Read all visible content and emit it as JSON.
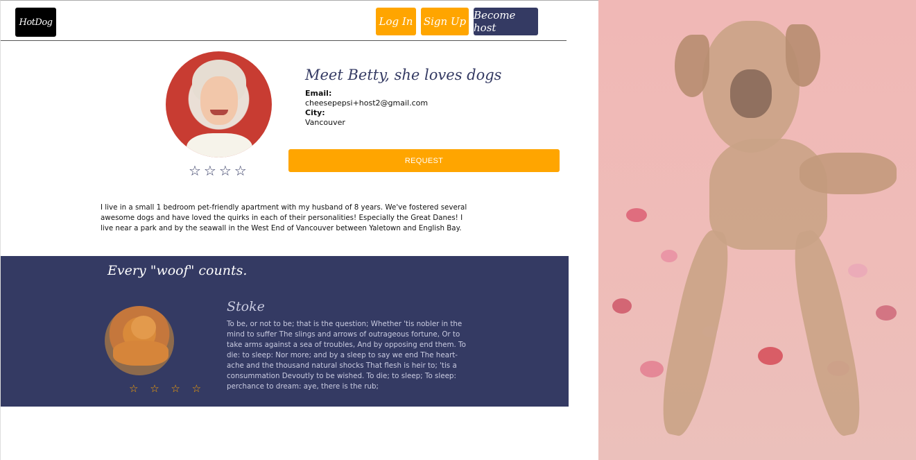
{
  "nav": {
    "logo": "HotDog",
    "login_label": "Log In",
    "signup_label": "Sign Up",
    "host_label": "Become host"
  },
  "host": {
    "title": "Meet Betty, she loves dogs",
    "email_label": "Email:",
    "email": "cheesepepsi+host2@gmail.com",
    "city_label": "City:",
    "city": "Vancouver",
    "stars": "☆☆☆☆",
    "rating_stars": 0,
    "request_label": "REQUEST",
    "bio": "I live in a small 1 bedroom pet-friendly apartment with my husband of 8 years. We've fostered several awesome dogs and have loved the quirks in each of their personalities! Especially the Great Danes! I live near a park and by the seawall in the West End of Vancouver between Yaletown and English Bay."
  },
  "reviews": {
    "title": "Every \"woof\" counts.",
    "items": [
      {
        "name": "Stoke",
        "stars": "☆ ☆ ☆ ☆",
        "text": "To be, or not to be; that is the question; Whether 'tis nobler in the mind to suffer The slings and arrows of outrageous fortune, Or to take arms against a sea of troubles, And by opposing end them. To die: to sleep: Nor more; and by a sleep to say we end The heart-ache and the thousand natural shocks That flesh is heir to; 'tis a consummation Devoutly to be wished. To die; to sleep; To sleep: perchance to dream: aye, there is the rub;"
      }
    ]
  },
  "colors": {
    "accent": "#ffa500",
    "navy": "#343a63",
    "hero_bg": "#f0b8b6"
  }
}
